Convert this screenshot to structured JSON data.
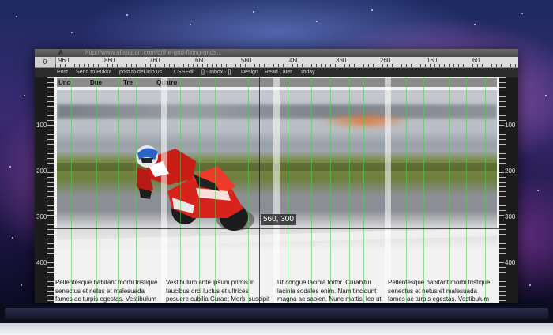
{
  "window": {
    "title_text": "http://www.alistapart.com/d/the-grid-fixing-grids...",
    "tab_marker": "A"
  },
  "ruler": {
    "corner": "0",
    "top_labels": [
      "960",
      "860",
      "760",
      "660",
      "560",
      "460",
      "360",
      "260",
      "160",
      "60"
    ],
    "left_labels": [
      "100",
      "200",
      "300",
      "400"
    ],
    "right_labels": [
      "100",
      "200",
      "300",
      "400"
    ]
  },
  "bookmarks": [
    "Post",
    "Send to Pukka",
    "post to del.icio.us",
    "CSSEdit",
    "[] - Inbox - []",
    "Design",
    "Read Later",
    "Today"
  ],
  "nav": {
    "items": [
      "Uno",
      "Due",
      "Tre",
      "Quatro"
    ]
  },
  "crosshair": {
    "readout": "560, 300"
  },
  "content": {
    "columns": [
      "Pellentesque habitant morbi tristique senectus et netus et malesuada fames ac turpis egestas. Vestibulum tortor",
      "Vestibulum ante ipsum primis in faucibus orci luctus et ultrices posuere cubilia Curae; Morbi suscipit neque",
      "Ut congue lacinia tortor. Curabitur lacinia sodales enim. Nam tincidunt magna ac sapien. Nunc mattis, leo ut",
      "Pellentesque habitant morbi tristique senectus et netus et malesuada fames ac turpis egestas. Vestibulum tortor"
    ]
  },
  "photo": {
    "description_icon": "motorcycle-racer-image"
  },
  "colors": {
    "grid_line": "#46d246",
    "grid_column": "#ffffff",
    "bike_red": "#d8231c"
  }
}
